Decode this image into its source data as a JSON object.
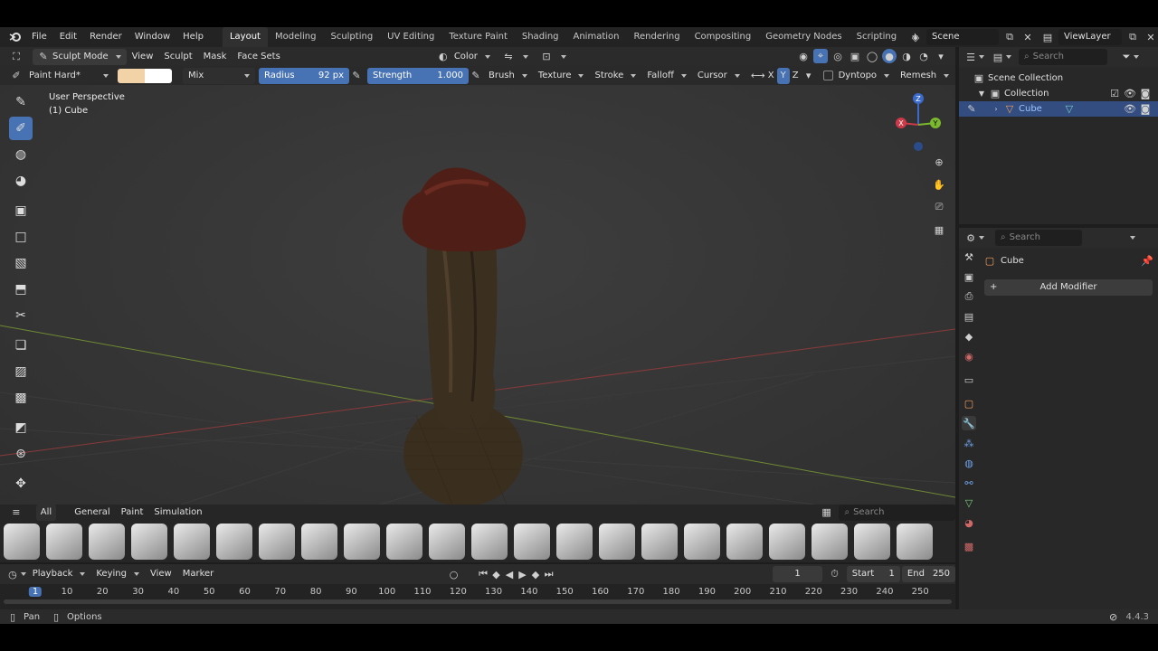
{
  "menu": [
    "File",
    "Edit",
    "Render",
    "Window",
    "Help"
  ],
  "workspaces": [
    "Layout",
    "Modeling",
    "Sculpting",
    "UV Editing",
    "Texture Paint",
    "Shading",
    "Animation",
    "Rendering",
    "Compositing",
    "Geometry Nodes",
    "Scripting"
  ],
  "scene": {
    "label": "Scene"
  },
  "viewlayer": {
    "label": "ViewLayer"
  },
  "viewport_header": {
    "mode": "Sculpt Mode",
    "view": "View",
    "sculpt": "Sculpt",
    "mask": "Mask",
    "face_sets": "Face Sets",
    "color": "Color"
  },
  "tool_settings": {
    "brush": "Paint Hard*",
    "blend": "Mix",
    "radius_label": "Radius",
    "radius_value": "92 px",
    "strength_label": "Strength",
    "strength_value": "1.000",
    "brush_menu": "Brush",
    "texture": "Texture",
    "stroke": "Stroke",
    "falloff": "Falloff",
    "cursor": "Cursor",
    "x": "X",
    "y": "Y",
    "z": "Z",
    "dyntopo": "Dyntopo",
    "remesh": "Remesh",
    "swatch_color": "#f2d3a8"
  },
  "viewport": {
    "perspective": "User Perspective",
    "object": "(1) Cube"
  },
  "gizmo": {
    "z": "Z",
    "y": "Y",
    "x": "X"
  },
  "asset_tabs": [
    "All",
    "General",
    "Paint",
    "Simulation"
  ],
  "asset_search_placeholder": "Search",
  "timeline": {
    "playback": "Playback",
    "keying": "Keying",
    "view": "View",
    "marker": "Marker",
    "current_frame": "1",
    "start_label": "Start",
    "start": "1",
    "end_label": "End",
    "end": "250",
    "ticks": [
      "1",
      "10",
      "20",
      "30",
      "40",
      "50",
      "60",
      "70",
      "80",
      "90",
      "100",
      "110",
      "120",
      "130",
      "140",
      "150",
      "160",
      "170",
      "180",
      "190",
      "200",
      "210",
      "220",
      "230",
      "240",
      "250"
    ]
  },
  "status": {
    "pan": "Pan",
    "options": "Options",
    "version": "4.4.3"
  },
  "outliner": {
    "search_placeholder": "Search",
    "scene_collection": "Scene Collection",
    "collection": "Collection",
    "cube": "Cube"
  },
  "properties": {
    "search_placeholder": "Search",
    "object": "Cube",
    "add_modifier": "Add Modifier"
  },
  "colors": {
    "accent": "#4772b3",
    "selected_row": "#334d80"
  }
}
